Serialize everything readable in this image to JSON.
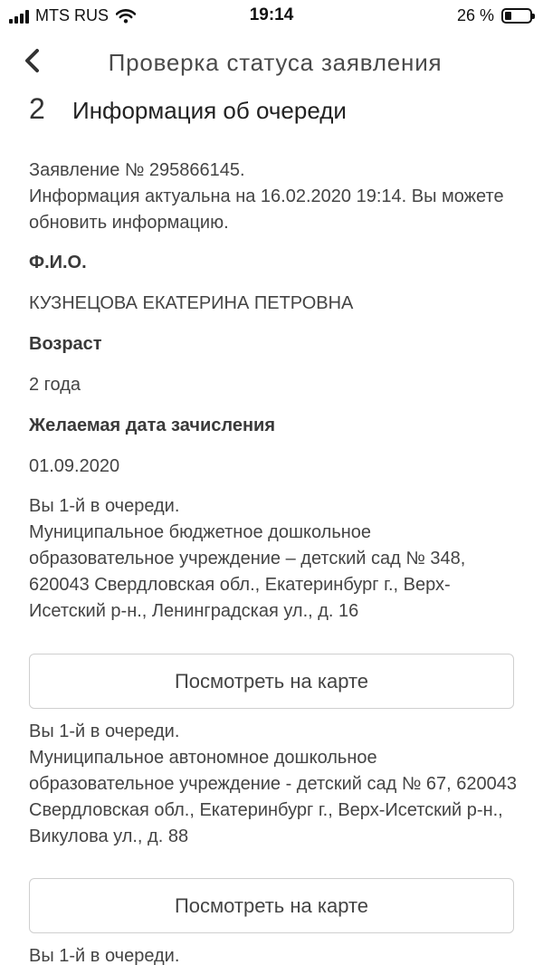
{
  "status_bar": {
    "carrier": "MTS RUS",
    "time": "19:14",
    "battery": "26 %",
    "battery_level": 0.26
  },
  "nav": {
    "title": "Проверка статуса заявления"
  },
  "step": {
    "number": "2",
    "title": "Информация об очереди"
  },
  "info": {
    "application": "Заявление № 295866145.",
    "actuality": "Информация актуальна на 16.02.2020 19:14. Вы можете обновить информацию."
  },
  "fields": {
    "fio_label": "Ф.И.О.",
    "fio_value": "КУЗНЕЦОВА ЕКАТЕРИНА ПЕТРОВНА",
    "age_label": "Возраст",
    "age_value": "2 года",
    "date_label": "Желаемая дата зачисления",
    "date_value": "01.09.2020"
  },
  "queue": [
    {
      "position": "Вы 1-й в очереди.",
      "institution": "Муниципальное бюджетное дошкольное образовательное учреждение – детский сад № 348, 620043 Свердловская обл., Екатеринбург г., Верх-Исетский р-н., Ленинградская ул., д. 16",
      "button": "Посмотреть на карте"
    },
    {
      "position": "Вы 1-й в очереди.",
      "institution": "Муниципальное автономное дошкольное образовательное учреждение - детский сад № 67, 620043 Свердловская обл., Екатеринбург г., Верх-Исетский р-н., Викулова ул., д. 88",
      "button": "Посмотреть на карте"
    },
    {
      "position": "Вы 1-й в очереди."
    }
  ]
}
